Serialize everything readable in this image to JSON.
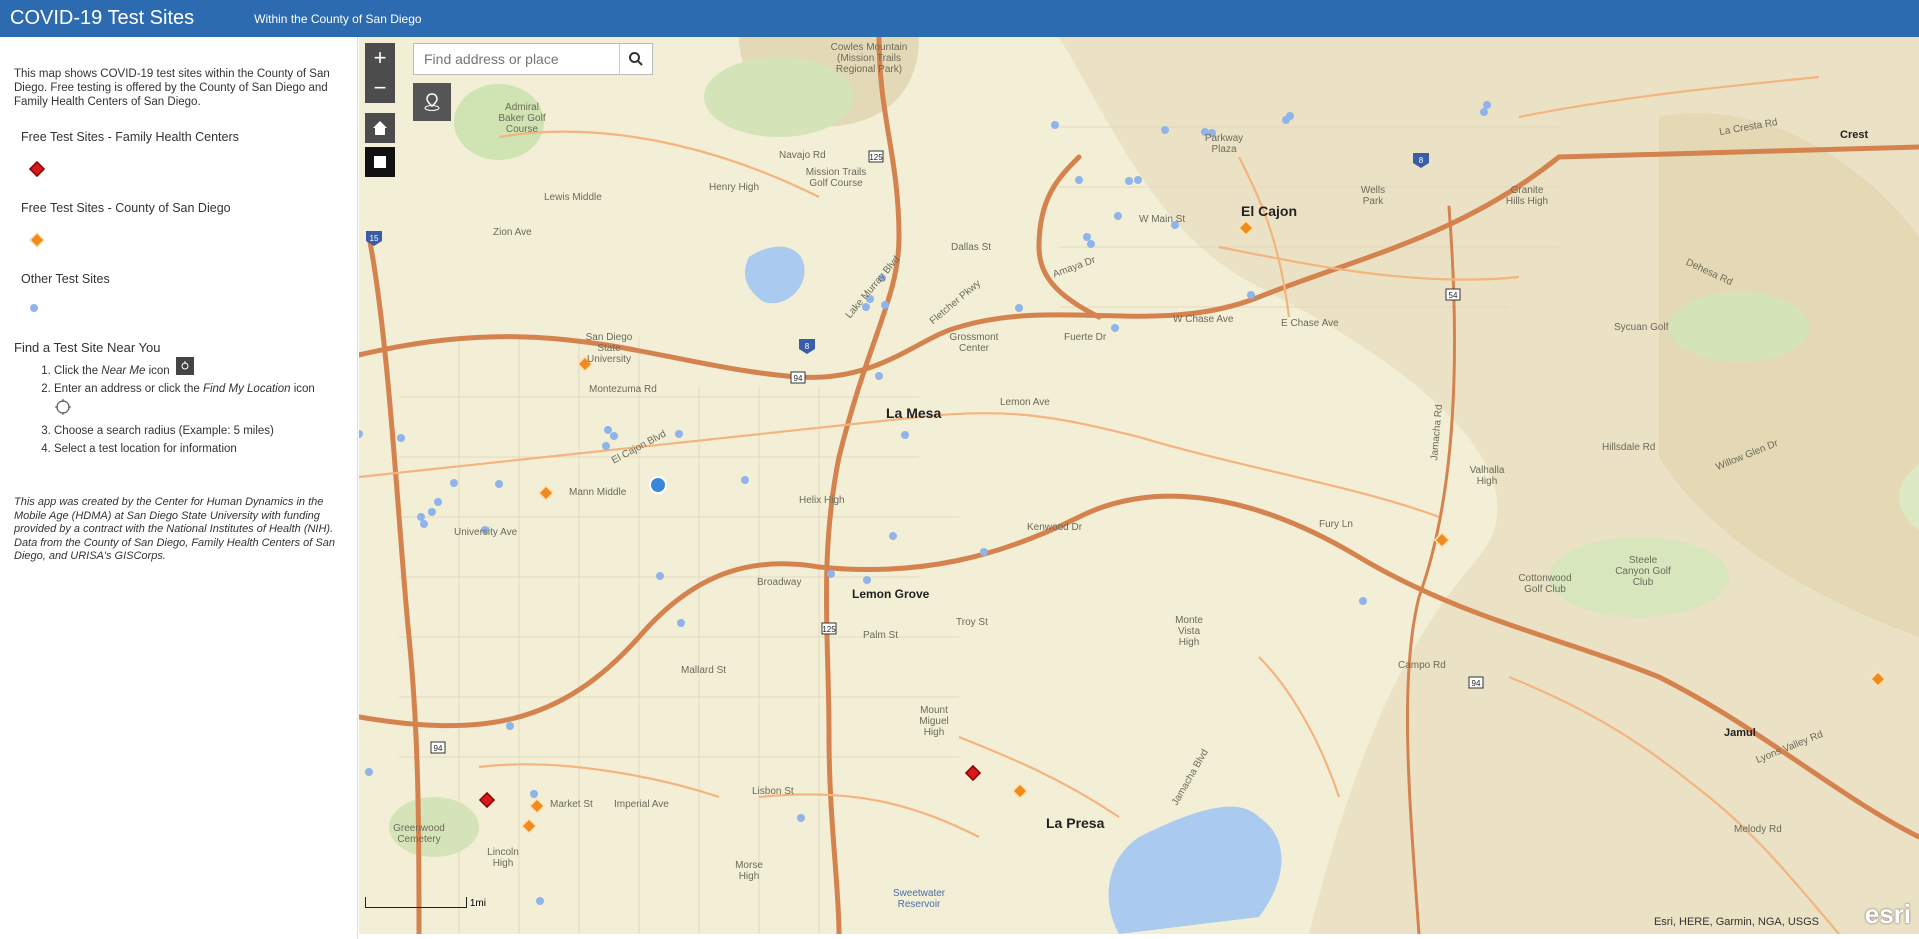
{
  "header": {
    "title": "COVID-19 Test Sites",
    "subtitle": "Within the County of San Diego"
  },
  "sidebar": {
    "intro": "This map shows COVID-19 test sites within the County of San Diego. Free testing is offered by the County of San Diego and Family Health Centers of San Diego.",
    "legend": [
      {
        "label": "Free Test Sites - Family Health Centers",
        "symbol": "red-diamond",
        "color": "#d7191c"
      },
      {
        "label": "Free Test Sites - County of San Diego",
        "symbol": "orange-diamond",
        "color": "#f08c1e"
      },
      {
        "label": "Other Test Sites",
        "symbol": "blue-dot",
        "color": "#8fb4ea"
      }
    ],
    "find_title": "Find a Test Site Near You",
    "steps": [
      {
        "prefix": "Click the ",
        "em": "Near Me",
        "suffix": " icon"
      },
      {
        "prefix": "Enter an address or click the ",
        "em": "Find My Location",
        "suffix": " icon"
      },
      {
        "prefix": "Choose a search radius (Example: 5 miles)",
        "em": "",
        "suffix": ""
      },
      {
        "prefix": "Select a test location for information",
        "em": "",
        "suffix": ""
      }
    ],
    "credit": "This app was created by the Center for Human Dynamics in the Mobile Age (HDMA) at San Diego State University with funding provided by a contract with the National Institutes of Health (NIH). Data from the County of San Diego, Family Health Centers of San Diego, and URISA's GISCorps."
  },
  "map": {
    "search_placeholder": "Find address or place",
    "zoom_in": "+",
    "zoom_out": "−",
    "attribution": "Esri, HERE, Garmin, NGA, USGS",
    "esri_logo": "esri",
    "scale_label": "1mi",
    "cities": [
      "El Cajon",
      "La Mesa",
      "Lemon Grove",
      "La Presa",
      "Crest",
      "Jamul"
    ],
    "places": [
      "Admiral Baker Golf Course",
      "Mission Trails Golf Course",
      "Cowles Mountain (Mission Trails Regional Park)",
      "Henry High",
      "Grossmont Center",
      "San Diego State University",
      "Lewis Middle",
      "Zion Ave",
      "Helix High",
      "Mann Middle",
      "University Ave",
      "Montezuma Rd",
      "El Cajon Blvd",
      "Navajo Rd",
      "Lake Murray Blvd",
      "Dallas St",
      "Fletcher Pkwy",
      "Amaya Dr",
      "Fuerte Dr",
      "Lemon Ave",
      "Broadway",
      "Troy St",
      "Palm St",
      "Mallard St",
      "Market St",
      "Imperial Ave",
      "Lisbon St",
      "Campo Rd",
      "Kenwood Dr",
      "Fury Ln",
      "E Chase Ave",
      "W Chase Ave",
      "W Main St",
      "Wells Park",
      "Granite Hills High",
      "Parkway Plaza",
      "Valhalla High",
      "Cottonwood Golf Club",
      "Steele Canyon Golf Club",
      "Monte Vista High",
      "Mount Miguel High",
      "Sycuan Golf",
      "Sweetwater Reservoir",
      "Lincoln High",
      "Greenwood Cemetery",
      "Morse High",
      "Willow Glen Dr",
      "Hillsdale Rd",
      "Dehesa Rd",
      "La Cresta Rd",
      "Jamacha Rd",
      "Jamacha Blvd",
      "Lyons Valley Rd",
      "Melody Rd"
    ]
  }
}
